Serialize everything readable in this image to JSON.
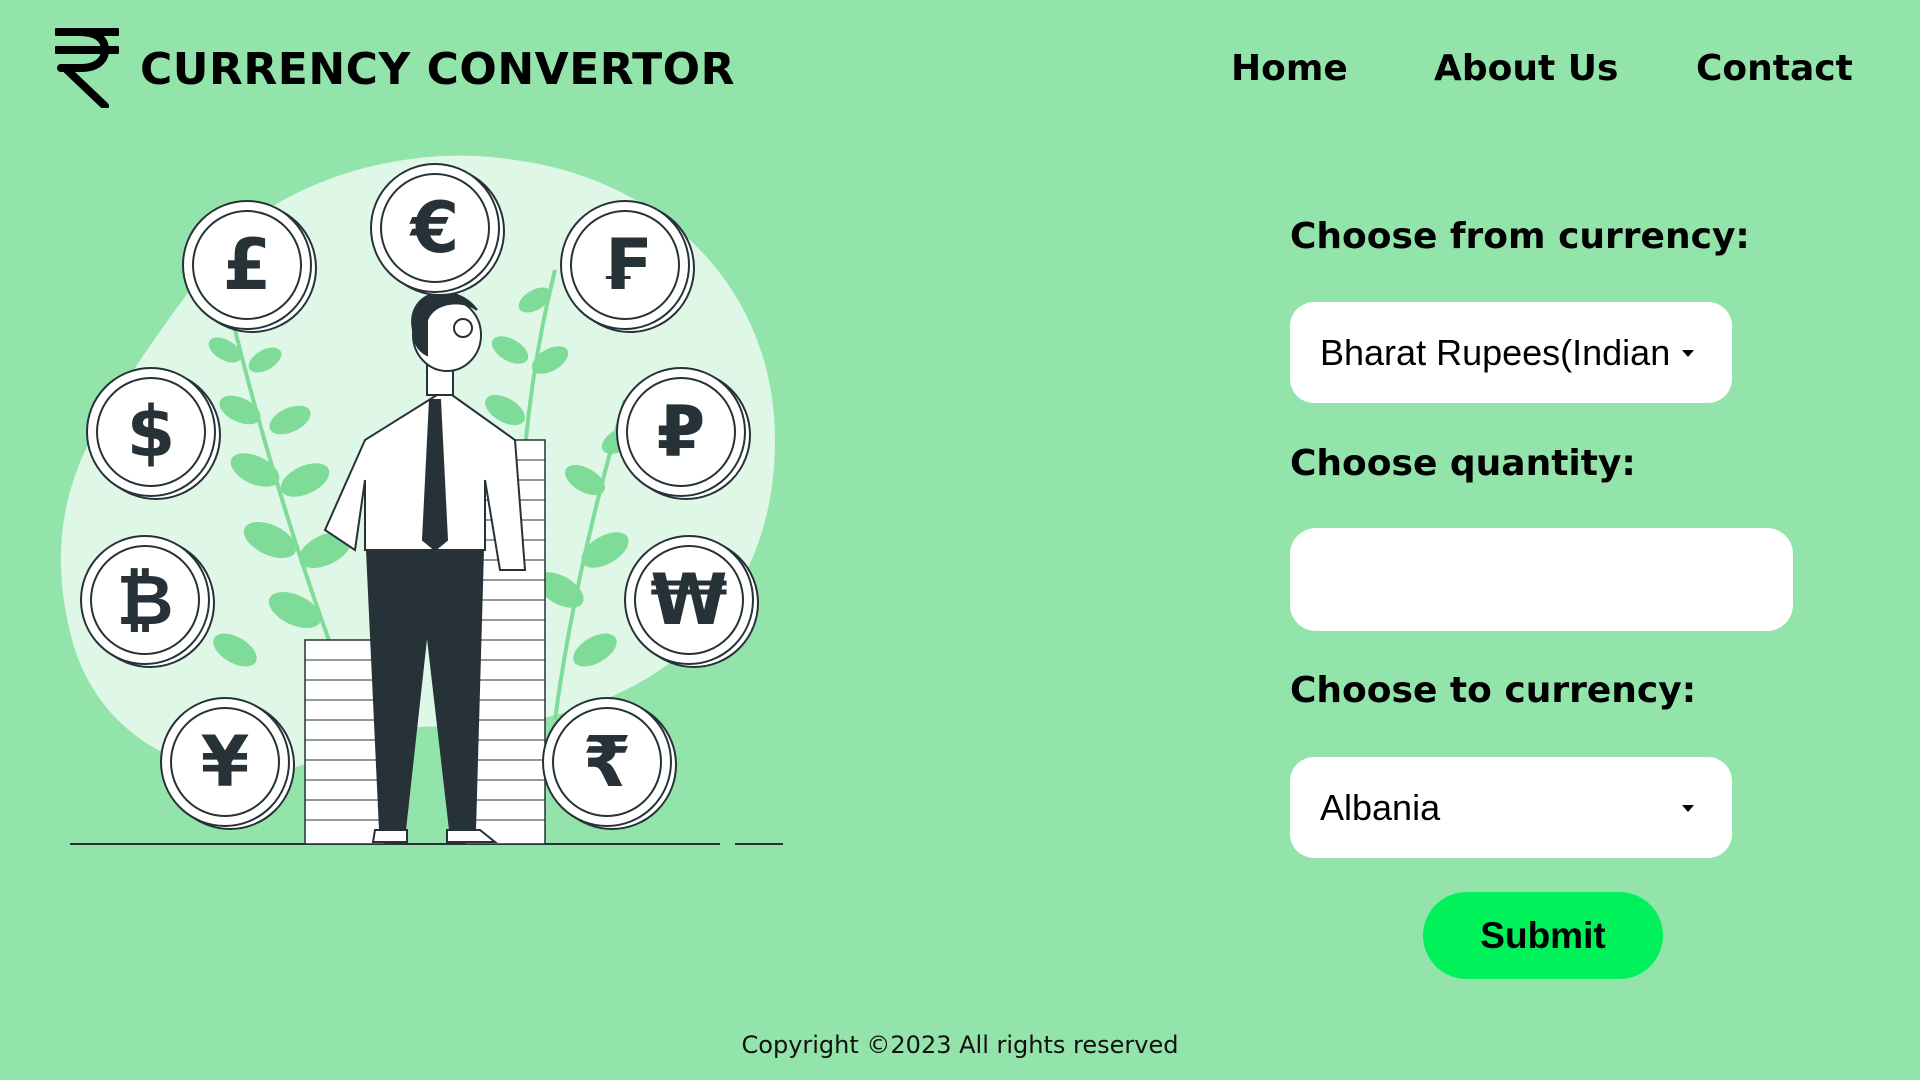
{
  "header": {
    "brand": "CURRENCY CONVERTOR",
    "nav": [
      "Home",
      "About Us",
      "Contact"
    ]
  },
  "form": {
    "from_label": "Choose from currency:",
    "from_value": "Bharat Rupees(Indian",
    "quantity_label": "Choose quantity:",
    "quantity_value": "",
    "to_label": "Choose to currency:",
    "to_value": "Albania",
    "submit_label": "Submit"
  },
  "illustration": {
    "coins": [
      {
        "symbol": "£",
        "icon": "pound-coin-icon"
      },
      {
        "symbol": "€",
        "icon": "euro-coin-icon"
      },
      {
        "symbol": "₣",
        "icon": "franc-coin-icon"
      },
      {
        "symbol": "$",
        "icon": "dollar-coin-icon"
      },
      {
        "symbol": "₽",
        "icon": "ruble-coin-icon"
      },
      {
        "symbol": "₿",
        "icon": "bitcoin-coin-icon"
      },
      {
        "symbol": "₩",
        "icon": "won-coin-icon"
      },
      {
        "symbol": "¥",
        "icon": "yen-coin-icon"
      },
      {
        "symbol": "₹",
        "icon": "rupee-coin-icon"
      }
    ]
  },
  "footer": {
    "copyright": "Copyright ©2023 All rights reserved"
  },
  "colors": {
    "background": "#93e4aa",
    "submit": "#00f15a",
    "ink": "#263238",
    "leaf": "#7fdc98",
    "blob": "#dff7e6"
  }
}
